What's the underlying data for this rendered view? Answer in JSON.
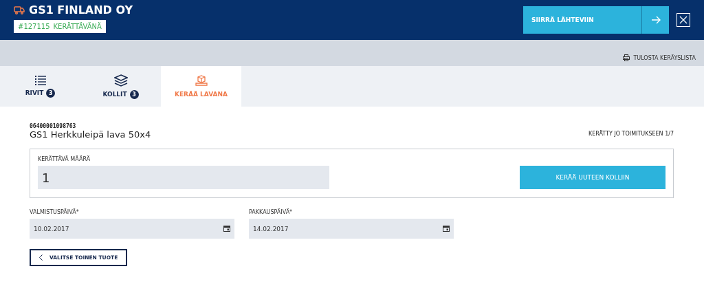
{
  "header": {
    "company": "GS1 FINLAND OY",
    "order_number": "#127115",
    "order_status": "KERÄTTÄVÄNÄ",
    "action_button": "SIIRRÄ LÄHTEVIIN"
  },
  "toolbar": {
    "print_link": "TULOSTA KERÄYSLISTA"
  },
  "tabs": [
    {
      "label": "RIVIT",
      "count": "3",
      "kind": "list",
      "selected": false
    },
    {
      "label": "KOLLIT",
      "count": "3",
      "kind": "stack",
      "selected": false
    },
    {
      "label": "KERÄÄ LAVANA",
      "kind": "pallet",
      "selected": true
    }
  ],
  "product": {
    "code": "06400001098763",
    "name": "GS1 Herkkuleipä lava 50x4",
    "collected": "KERÄTTY JO TOIMITUKSEEN 1/7"
  },
  "quantity": {
    "label": "KERÄTTÄVÄ MÄÄRÄ",
    "value": "1",
    "button": "KERÄÄ UUTEEN KOLLIIN"
  },
  "dates": [
    {
      "label": "VALMISTUSPÄIVÄ*",
      "value": "10.02.2017"
    },
    {
      "label": "PAKKAUSPÄIVÄ*",
      "value": "14.02.2017"
    }
  ],
  "back_button": "VALITSE TOINEN TUOTE"
}
